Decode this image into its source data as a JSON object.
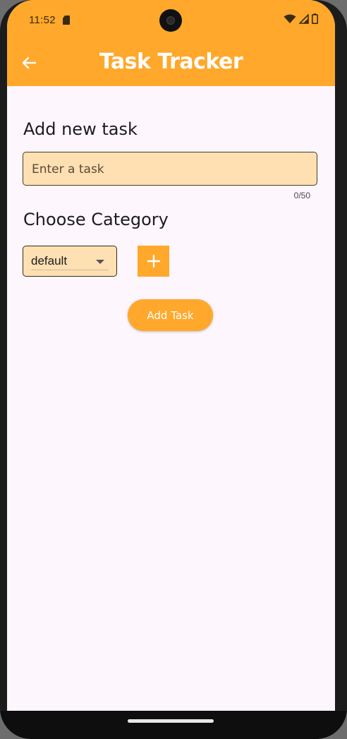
{
  "status_bar": {
    "time": "11:52",
    "icons": [
      "sd-card-icon",
      "wifi-icon",
      "signal-icon",
      "battery-icon"
    ]
  },
  "app_bar": {
    "title": "Task Tracker",
    "back_icon": "arrow-back-icon",
    "background_color": "#ffa82b"
  },
  "task_section": {
    "heading": "Add new task",
    "input_placeholder": "Enter a task",
    "input_value": "",
    "counter": "0/50"
  },
  "category_section": {
    "heading": "Choose Category",
    "selected": "default",
    "add_icon": "plus-icon"
  },
  "actions": {
    "add_task_label": "Add Task"
  },
  "colors": {
    "accent": "#ffa82b",
    "input_fill": "#ffe0b2",
    "background": "#fdf6fd"
  }
}
